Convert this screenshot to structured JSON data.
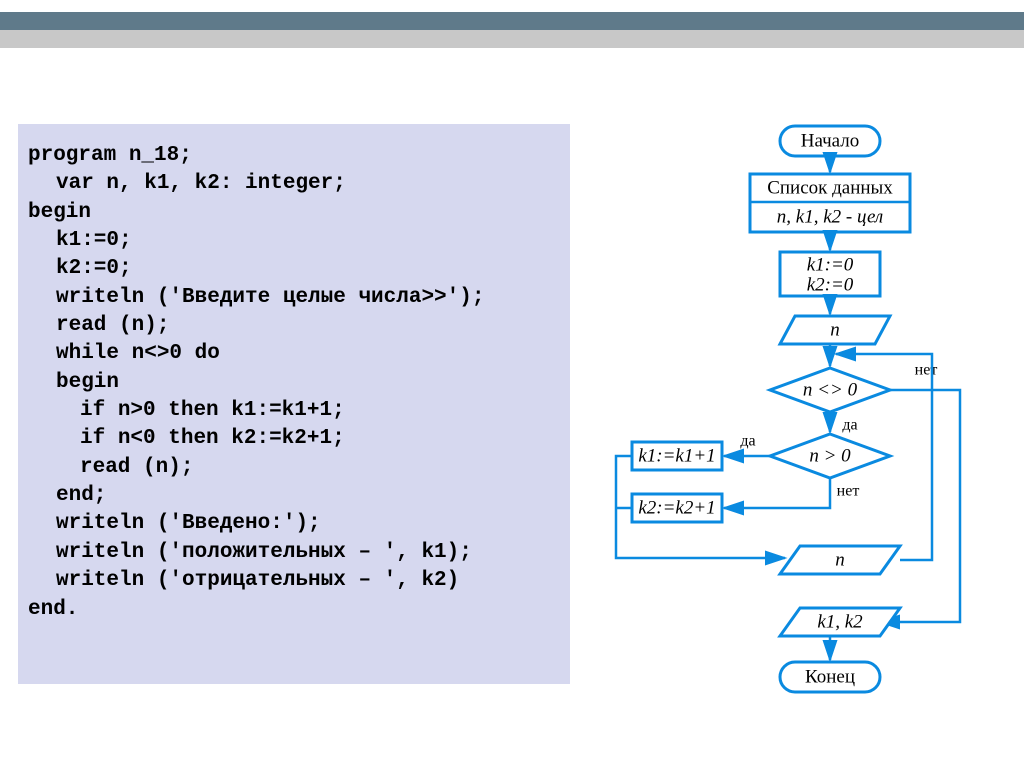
{
  "code": {
    "l1a": "program",
    "l1b": " n_18;",
    "l2a": "var",
    "l2b": " n, k1, k2: integer;",
    "l3": "begin",
    "l4": "k1:=0;",
    "l5": "k2:=0;",
    "l6": "writeln ('Введите целые числа>>');",
    "l7": "read (n);",
    "l8a": "while",
    "l8b": " n<>0 ",
    "l8c": "do",
    "l9": "begin",
    "l10a": "if",
    "l10b": " n>0 ",
    "l10c": "then",
    "l10d": " k1:=k1+1;",
    "l11a": "if",
    "l11b": " n<0 ",
    "l11c": "then",
    "l11d": " k2:=k2+1;",
    "l12": "read (n);",
    "l13": "end;",
    "l14": "writeln ('Введено:');",
    "l15": "writeln ('положительных – ', k1);",
    "l16": "writeln ('отрицательных – ', k2)",
    "l17": "end."
  },
  "fc": {
    "start": "Начало",
    "datalist": "Список данных",
    "vars": "n, k1, k2 - цел",
    "init1": "k1:=0",
    "init2": "k2:=0",
    "readn": "n",
    "cond1": "n <> 0",
    "cond2": "n > 0",
    "act1": "k1:=k1+1",
    "act2": "k2:=k2+1",
    "readn2": "n",
    "out": "k1, k2",
    "end": "Конец",
    "yes": "да",
    "no": "нет"
  }
}
